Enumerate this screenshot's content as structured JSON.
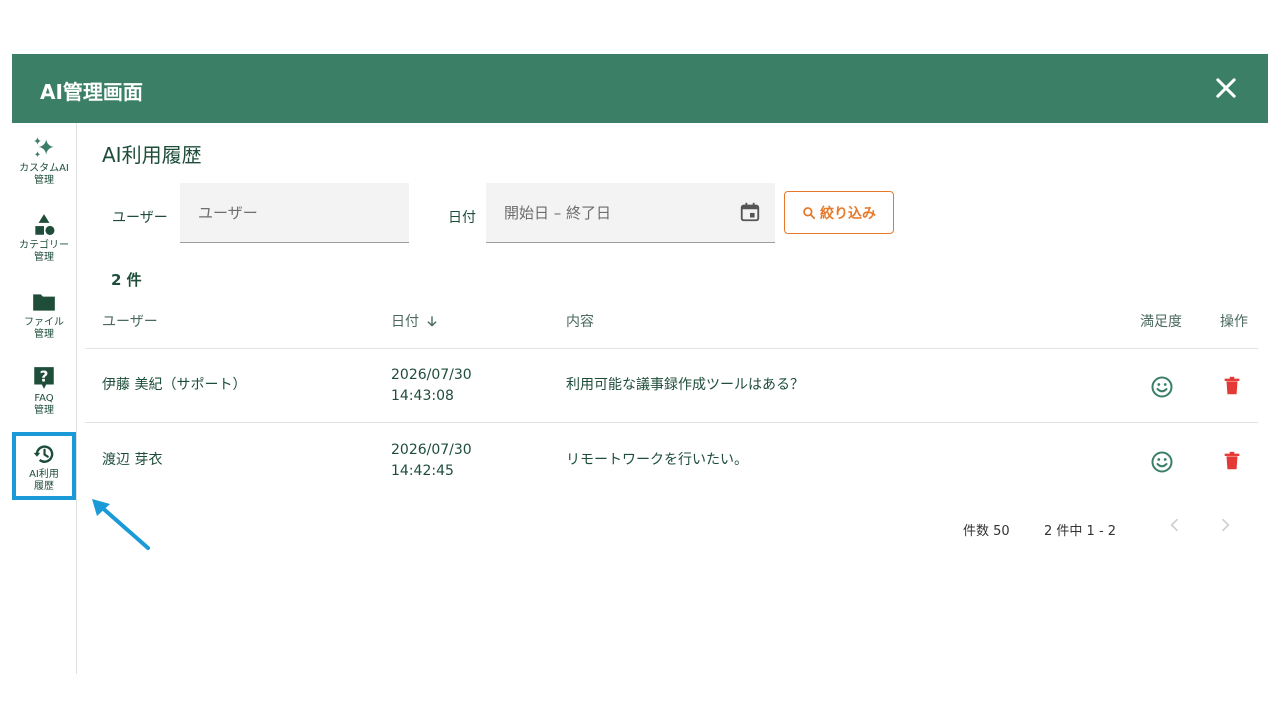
{
  "window": {
    "title": "AI管理画面"
  },
  "sidebar": {
    "items": [
      {
        "label": "カスタムAI\n管理",
        "icon": "sparkle-icon"
      },
      {
        "label": "カテゴリー\n管理",
        "icon": "shapes-icon"
      },
      {
        "label": "ファイル\n管理",
        "icon": "folder-icon"
      },
      {
        "label": "FAQ\n管理",
        "icon": "question-icon"
      },
      {
        "label": "AI利用\n履歴",
        "icon": "history-icon",
        "active": true
      }
    ]
  },
  "page": {
    "title": "AI利用履歴"
  },
  "filters": {
    "user_label": "ユーザー",
    "user_placeholder": "ユーザー",
    "date_label": "日付",
    "date_placeholder": "開始日 – 終了日",
    "filter_button": "絞り込み"
  },
  "result_count": "2 件",
  "table": {
    "headers": {
      "user": "ユーザー",
      "date": "日付",
      "content": "内容",
      "satisfaction": "満足度",
      "actions": "操作"
    },
    "rows": [
      {
        "user": "伊藤 美紀（サポート）",
        "date": "2026/07/30",
        "time": "14:43:08",
        "content": "利用可能な議事録作成ツールはある？"
      },
      {
        "user": "渡辺 芽衣",
        "date": "2026/07/30",
        "time": "14:42:45",
        "content": "リモートワークを行いたい。"
      }
    ]
  },
  "pagination": {
    "page_size": "件数 50",
    "range": "2 件中 1 - 2"
  },
  "colors": {
    "header": "#3a7f66",
    "accent": "#e7792b",
    "delete": "#e53935",
    "highlight": "#1a9ad6"
  }
}
